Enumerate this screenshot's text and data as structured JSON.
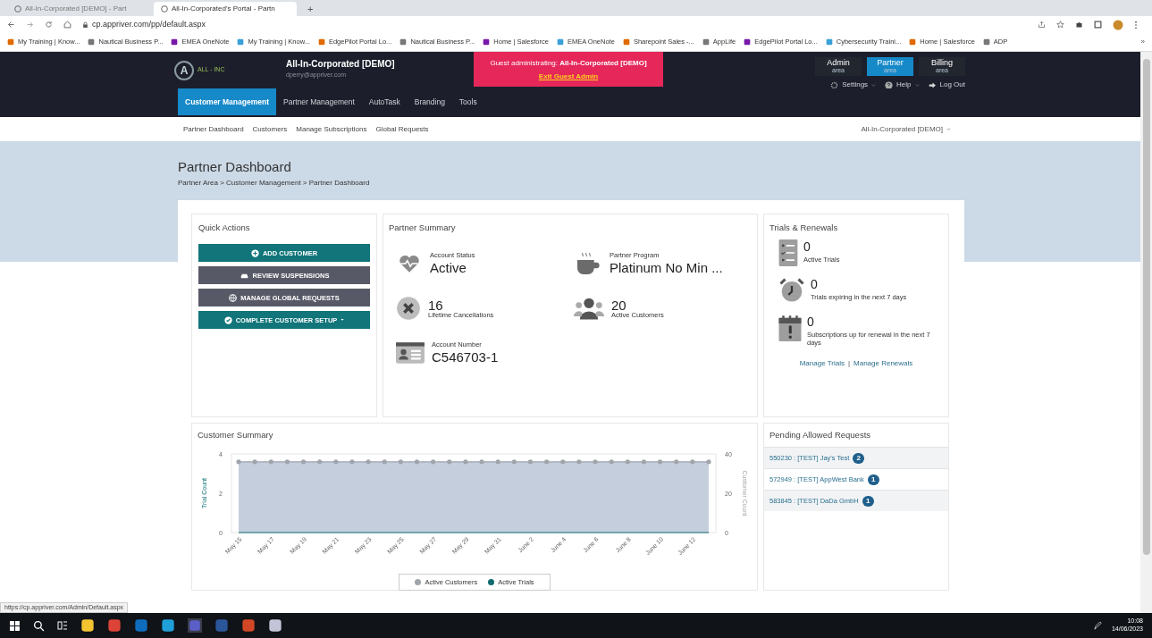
{
  "browser": {
    "tabs": [
      {
        "title": "All-In-Corporated [DEMO] - Part",
        "selected": false
      },
      {
        "title": "All-In-Corporated's Portal - Partn",
        "selected": true
      }
    ],
    "new_tab": "+",
    "address": "cp.appriver.com/pp/default.aspx",
    "bookmarks": [
      "My Training | Know...",
      "Nautical Business P...",
      "EMEA OneNote",
      "My Training | Know...",
      "EdgePilot Portal Lo...",
      "Nautical Business P...",
      "Home | Salesforce",
      "EMEA OneNote",
      "Sharepoint Sales -...",
      "AppLife",
      "EdgePilot Portal Lo...",
      "Cybersecurity Traini...",
      "Home | Salesforce",
      "ADP"
    ],
    "more": "»"
  },
  "header": {
    "logo": {
      "mark": "A",
      "text": "ALL - INC"
    },
    "company": "All-In-Corporated [DEMO]",
    "email": "dperry@appriver.com",
    "guest_banner": {
      "text": "Guest administrating: **All-In-Corporated [DEMO]**",
      "link": "Exit Guest Admin"
    },
    "areas": [
      {
        "label": "Admin",
        "sub": "area",
        "selected": false
      },
      {
        "label": "Partner",
        "sub": "area",
        "selected": true
      },
      {
        "label": "Billing",
        "sub": "area",
        "selected": false
      }
    ],
    "menus": [
      {
        "label": "Settings",
        "kind": "gear"
      },
      {
        "label": "Help",
        "kind": "help"
      },
      {
        "label": "Log Out",
        "kind": "logout"
      }
    ]
  },
  "nav": [
    {
      "label": "Customer Management",
      "selected": true
    },
    {
      "label": "Partner Management",
      "selected": false
    },
    {
      "label": "AutoTask",
      "selected": false
    },
    {
      "label": "Branding",
      "selected": false
    },
    {
      "label": "Tools",
      "selected": false
    }
  ],
  "subnav": [
    "Partner Dashboard",
    "Customers",
    "Manage Subscriptions",
    "Global Requests"
  ],
  "account_switcher": "All-In-Corporated [DEMO]",
  "page": {
    "title": "Partner Dashboard",
    "breadcrumb": "Partner Area > Customer Management > Partner Dashboard"
  },
  "quick_actions": {
    "title": "Quick Actions",
    "buttons": [
      {
        "label": "ADD CUSTOMER",
        "kind": "add"
      },
      {
        "label": "REVIEW SUSPENSIONS",
        "kind": "suspend"
      },
      {
        "label": "MANAGE GLOBAL REQUESTS",
        "kind": "globe"
      },
      {
        "label": "COMPLETE CUSTOMER SETUP",
        "kind": "setup"
      }
    ]
  },
  "partner_summary": {
    "title": "Partner Summary",
    "stats": [
      {
        "kind": "heart",
        "label": "Account Status",
        "value": "Active"
      },
      {
        "kind": "cup",
        "label": "Partner Program",
        "value": "Platinum No Min ..."
      },
      {
        "kind": "cross",
        "label": "Lifetime Cancellations",
        "value": "16"
      },
      {
        "kind": "people",
        "label": "Active Customers",
        "value": "20"
      },
      {
        "kind": "card",
        "label": "Account Number",
        "value": "C546703-1"
      }
    ]
  },
  "trials": {
    "title": "Trials & Renewals",
    "items": [
      {
        "kind": "list",
        "value": "0",
        "label": "Active Trials"
      },
      {
        "kind": "clock",
        "value": "0",
        "label": "Trials expiring in the next 7 days"
      },
      {
        "kind": "calendar",
        "value": "0",
        "label": "Subscriptions up for renewal in the next 7 days"
      }
    ],
    "links": [
      "Manage Trials",
      "Manage Renewals"
    ],
    "separator": "|"
  },
  "customer_summary": {
    "title": "Customer Summary",
    "chart_data": {
      "type": "line",
      "ylabel": "Trial Count",
      "y2label": "Customer Count",
      "categories": [
        "May 15",
        null,
        "May 17",
        null,
        "May 19",
        null,
        "May 21",
        null,
        "May 23",
        null,
        "May 25",
        null,
        "May 27",
        null,
        "May 29",
        null,
        "May 31",
        null,
        "June 2",
        null,
        "June 4",
        null,
        "June 6",
        null,
        "June 8",
        null,
        "June 10",
        null,
        "June 12",
        null
      ],
      "ylim": [
        0,
        4
      ],
      "yticks": [
        0,
        2,
        4
      ],
      "y2lim": [
        0,
        40
      ],
      "y2ticks": [
        0,
        20,
        40
      ],
      "series": [
        {
          "name": "Active Customers",
          "color": "#a0a4ab",
          "axis": "y2",
          "values": [
            36,
            36,
            36,
            36,
            36,
            36,
            36,
            36,
            36,
            36,
            36,
            36,
            36,
            36,
            36,
            36,
            36,
            36,
            36,
            36,
            36,
            36,
            36,
            36,
            36,
            36,
            36,
            36,
            36,
            36
          ]
        },
        {
          "name": "Active Trials",
          "color": "#0f6b6e",
          "values": [
            0,
            0,
            0,
            0,
            0,
            0,
            0,
            0,
            0,
            0,
            0,
            0,
            0,
            0,
            0,
            0,
            0,
            0,
            0,
            0,
            0,
            0,
            0,
            0,
            0,
            0,
            0,
            0,
            0,
            0
          ]
        }
      ]
    }
  },
  "pending": {
    "title": "Pending Allowed Requests",
    "items": [
      {
        "label": "550230 : [TEST] Jay's Test",
        "count": "2"
      },
      {
        "label": "572949 : [TEST] AppWest Bank",
        "count": "1"
      },
      {
        "label": "583845 : [TEST] DaDa GmbH",
        "count": "1"
      }
    ]
  },
  "status_url": "https://cp.appriver.com/Admin/Default.aspx",
  "taskbar": {
    "time": "10:08",
    "date": "14/06/2023"
  }
}
